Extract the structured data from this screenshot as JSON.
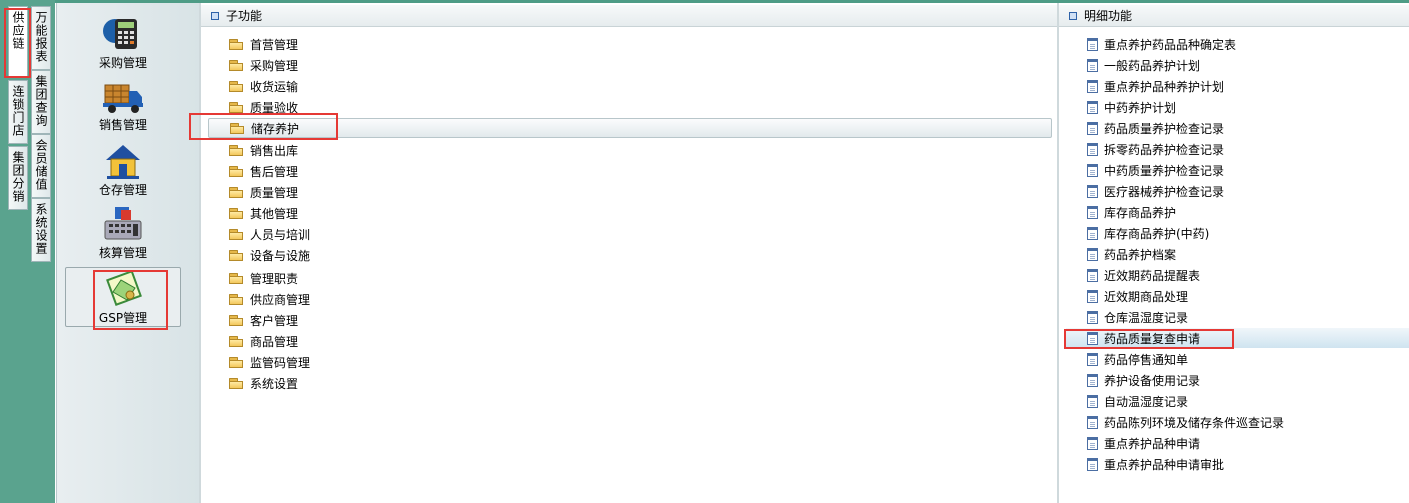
{
  "tabs_outer": [
    {
      "label": "供应链",
      "active": true
    },
    {
      "label": "连锁门店",
      "active": false
    },
    {
      "label": "集团分销",
      "active": false
    }
  ],
  "tabs_inner": [
    {
      "label": "万能报表"
    },
    {
      "label": "集团查询"
    },
    {
      "label": "会员储值"
    },
    {
      "label": "系统设置"
    }
  ],
  "modules": [
    {
      "label": "采购管理",
      "icon": "purchase-calculator-icon"
    },
    {
      "label": "销售管理",
      "icon": "sales-truck-icon"
    },
    {
      "label": "仓存管理",
      "icon": "warehouse-house-icon"
    },
    {
      "label": "核算管理",
      "icon": "accounting-calculator-icon"
    },
    {
      "label": "GSP管理",
      "icon": "gsp-certificate-icon",
      "selected": true
    }
  ],
  "sub_functions": {
    "title": "子功能",
    "items": [
      "首营管理",
      "采购管理",
      "收货运输",
      "质量验收",
      "储存养护",
      "销售出库",
      "售后管理",
      "质量管理",
      "其他管理",
      "人员与培训",
      "设备与设施",
      "管理职责",
      "供应商管理",
      "客户管理",
      "商品管理",
      "监管码管理",
      "系统设置"
    ],
    "selected": "储存养护"
  },
  "detail_functions": {
    "title": "明细功能",
    "items": [
      "重点养护药品品种确定表",
      "一般药品养护计划",
      "重点养护品种养护计划",
      "中药养护计划",
      "药品质量养护检查记录",
      "拆零药品养护检查记录",
      "中药质量养护检查记录",
      "医疗器械养护检查记录",
      "库存商品养护",
      "库存商品养护(中药)",
      "药品养护档案",
      "近效期药品提醒表",
      "近效期商品处理",
      "仓库温湿度记录",
      "药品质量复查申请",
      "药品停售通知单",
      "养护设备使用记录",
      "自动温湿度记录",
      "药品陈列环境及储存条件巡查记录",
      "重点养护品种申请",
      "重点养护品种申请审批"
    ],
    "selected": "药品质量复查申请"
  },
  "colors": {
    "frame": "#5aa38e",
    "highlight": "#e53935",
    "accent": "#2e62a8"
  }
}
